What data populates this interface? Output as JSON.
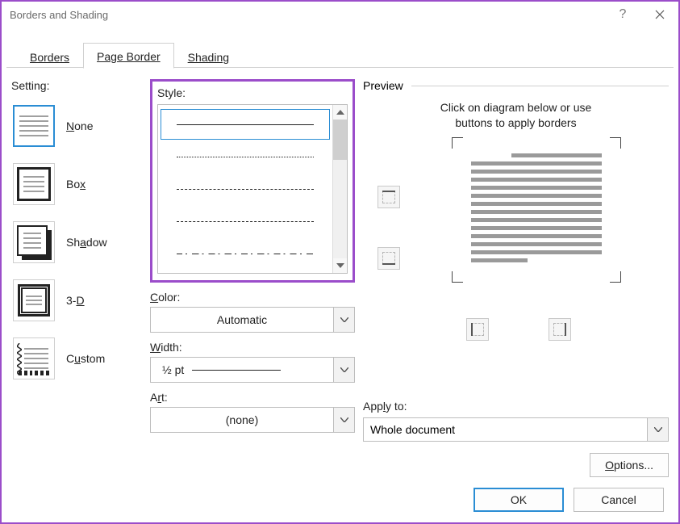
{
  "window": {
    "title": "Borders and Shading"
  },
  "tabs": {
    "borders": "Borders",
    "page_border": "Page Border",
    "shading": "Shading",
    "active": "page_border"
  },
  "setting": {
    "label": "Setting:",
    "items": [
      {
        "id": "none",
        "label_pre": "",
        "label_ul": "N",
        "label_post": "one"
      },
      {
        "id": "box",
        "label_pre": "Bo",
        "label_ul": "x",
        "label_post": ""
      },
      {
        "id": "shadow",
        "label_pre": "Sh",
        "label_ul": "a",
        "label_post": "dow"
      },
      {
        "id": "3d",
        "label_pre": "3-",
        "label_ul": "D",
        "label_post": ""
      },
      {
        "id": "custom",
        "label_pre": "C",
        "label_ul": "u",
        "label_post": "stom"
      }
    ],
    "selected": "none"
  },
  "style": {
    "label_pre": "St",
    "label_ul": "y",
    "label_post": "le:"
  },
  "color": {
    "label_pre": "",
    "label_ul": "C",
    "label_post": "olor:",
    "value": "Automatic"
  },
  "width": {
    "label_pre": "",
    "label_ul": "W",
    "label_post": "idth:",
    "value": "½ pt"
  },
  "art": {
    "label_pre": "A",
    "label_ul": "r",
    "label_post": "t:",
    "value": "(none)"
  },
  "preview": {
    "label": "Preview",
    "hint_line1": "Click on diagram below or use",
    "hint_line2": "buttons to apply borders"
  },
  "apply_to": {
    "label_pre": "App",
    "label_ul": "l",
    "label_post": "y to:",
    "value": "Whole document"
  },
  "options_btn": {
    "pre": "",
    "ul": "O",
    "post": "ptions..."
  },
  "footer": {
    "ok": "OK",
    "cancel": "Cancel"
  }
}
